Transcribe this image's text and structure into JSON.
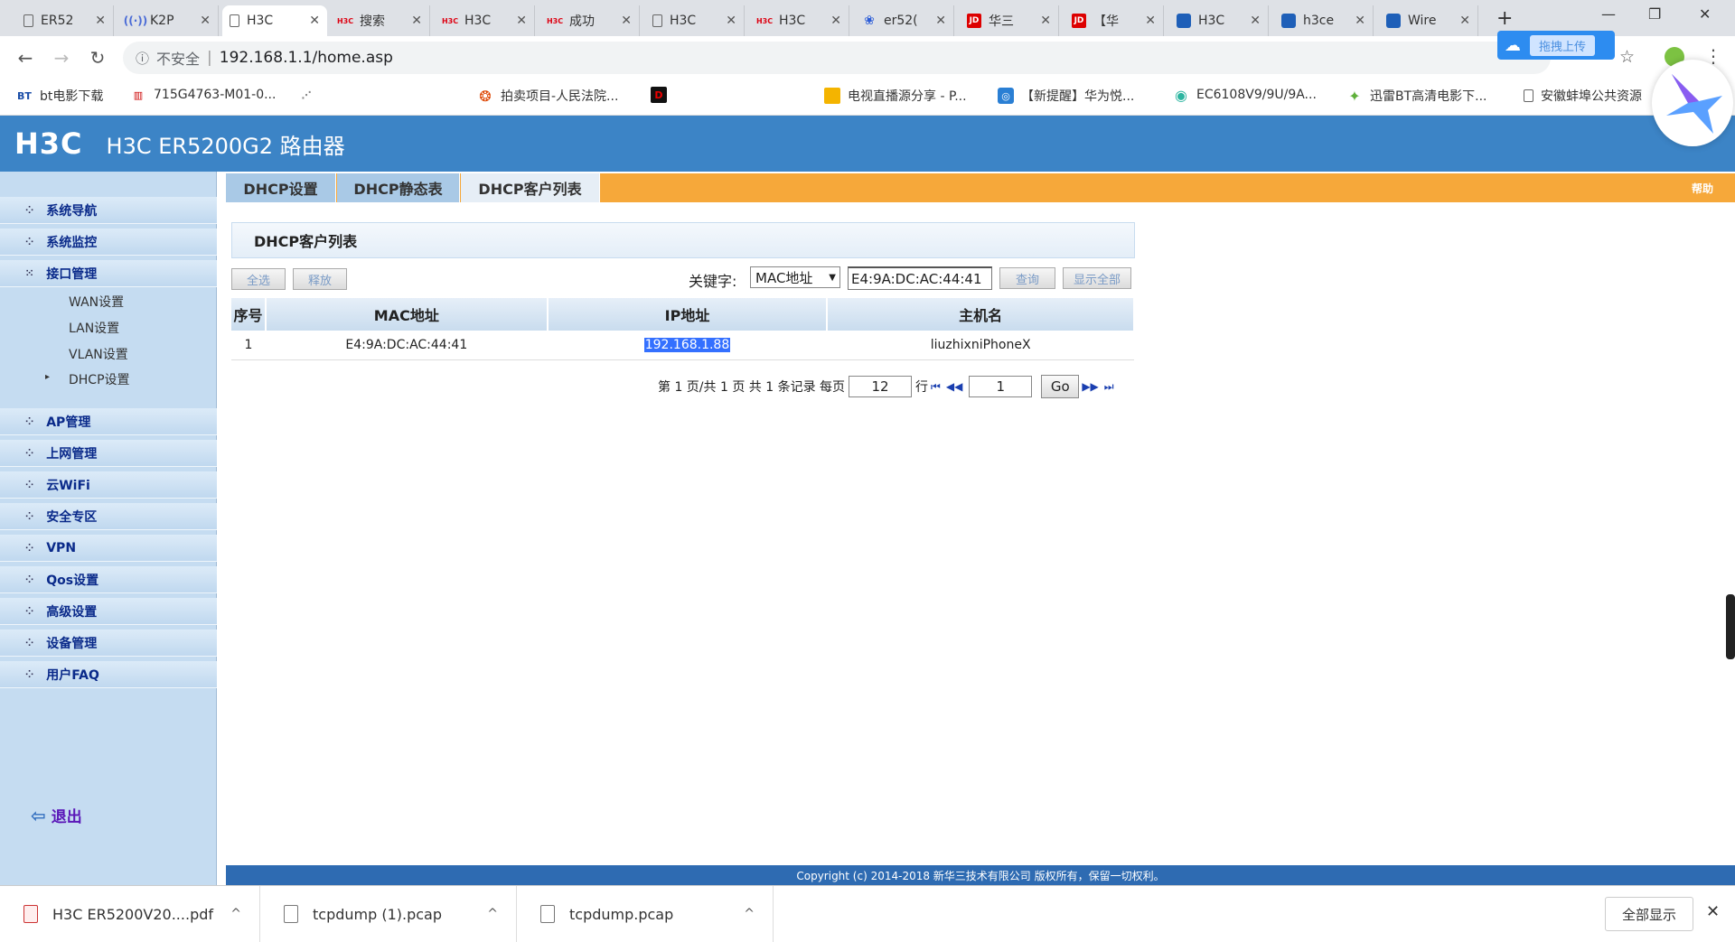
{
  "browser": {
    "tabs": [
      {
        "title": "ER52",
        "icon": "page-icon"
      },
      {
        "title": "K2P",
        "icon": "wave-icon"
      },
      {
        "title": "H3C",
        "icon": "page-icon",
        "active": true
      },
      {
        "title": "搜索",
        "icon": "h3c-icon"
      },
      {
        "title": "H3C",
        "icon": "h3c-icon"
      },
      {
        "title": "成功",
        "icon": "h3c-icon"
      },
      {
        "title": "H3C",
        "icon": "page-icon"
      },
      {
        "title": "H3C",
        "icon": "h3c-icon"
      },
      {
        "title": "er52(",
        "icon": "paw-icon"
      },
      {
        "title": "华三",
        "icon": "jd-icon"
      },
      {
        "title": "【华",
        "icon": "jd-icon"
      },
      {
        "title": "H3C",
        "icon": "shield-icon"
      },
      {
        "title": "h3ce",
        "icon": "shield-icon"
      },
      {
        "title": "Wire",
        "icon": "shield-icon"
      }
    ],
    "tab_close": "✕",
    "new_tab": "+",
    "window_controls": {
      "minimize": "—",
      "restore": "❐",
      "close": "✕"
    },
    "security_label": "不安全",
    "url": "192.168.1.1/home.asp",
    "cloud_upload_label": "拖拽上传",
    "bookmarks": [
      "bt电影下载",
      "715G4763-M01-0...",
      "拍卖项目-人民法院...",
      "电视直播源分享 - P...",
      "【新提醒】华为悦...",
      "EC6108V9/9U/9A...",
      "迅雷BT高清电影下...",
      "安徽蚌埠公共资源"
    ]
  },
  "router": {
    "logo": "H3C",
    "title": "H3C ER5200G2 路由器",
    "tabs": [
      "DHCP设置",
      "DHCP静态表",
      "DHCP客户列表"
    ],
    "help": "帮助",
    "menu": [
      "系统导航",
      "系统监控",
      "接口管理",
      "AP管理",
      "上网管理",
      "云WiFi",
      "安全专区",
      "VPN",
      "Qos设置",
      "高级设置",
      "设备管理",
      "用户FAQ"
    ],
    "submenu": [
      "WAN设置",
      "LAN设置",
      "VLAN设置",
      "DHCP设置"
    ],
    "logout": "退出",
    "section_title": "DHCP客户列表",
    "buttons": {
      "select_all": "全选",
      "release": "释放",
      "query": "查询",
      "show_all": "显示全部"
    },
    "keyword_label": "关键字:",
    "keyword_type": "MAC地址",
    "keyword_value": "E4:9A:DC:AC:44:41",
    "table": {
      "headers": [
        "序号",
        "MAC地址",
        "IP地址",
        "主机名"
      ],
      "rows": [
        {
          "index": "1",
          "mac": "E4:9A:DC:AC:44:41",
          "ip": "192.168.1.88",
          "hostname": "liuzhixniPhoneX"
        }
      ]
    },
    "pager": {
      "prefix": "第 1 页/共 1 页 共 1 条记录 每页",
      "per_page": "12",
      "rows_label": "行",
      "page_input": "1",
      "go": "Go"
    },
    "footer": "Copyright (c) 2014-2018 新华三技术有限公司 版权所有，保留一切权利。"
  },
  "downloads": {
    "items": [
      "H3C ER5200V20....pdf",
      "tcpdump (1).pcap",
      "tcpdump.pcap"
    ],
    "show_all": "全部显示",
    "chevron": "^",
    "close": "✕"
  }
}
